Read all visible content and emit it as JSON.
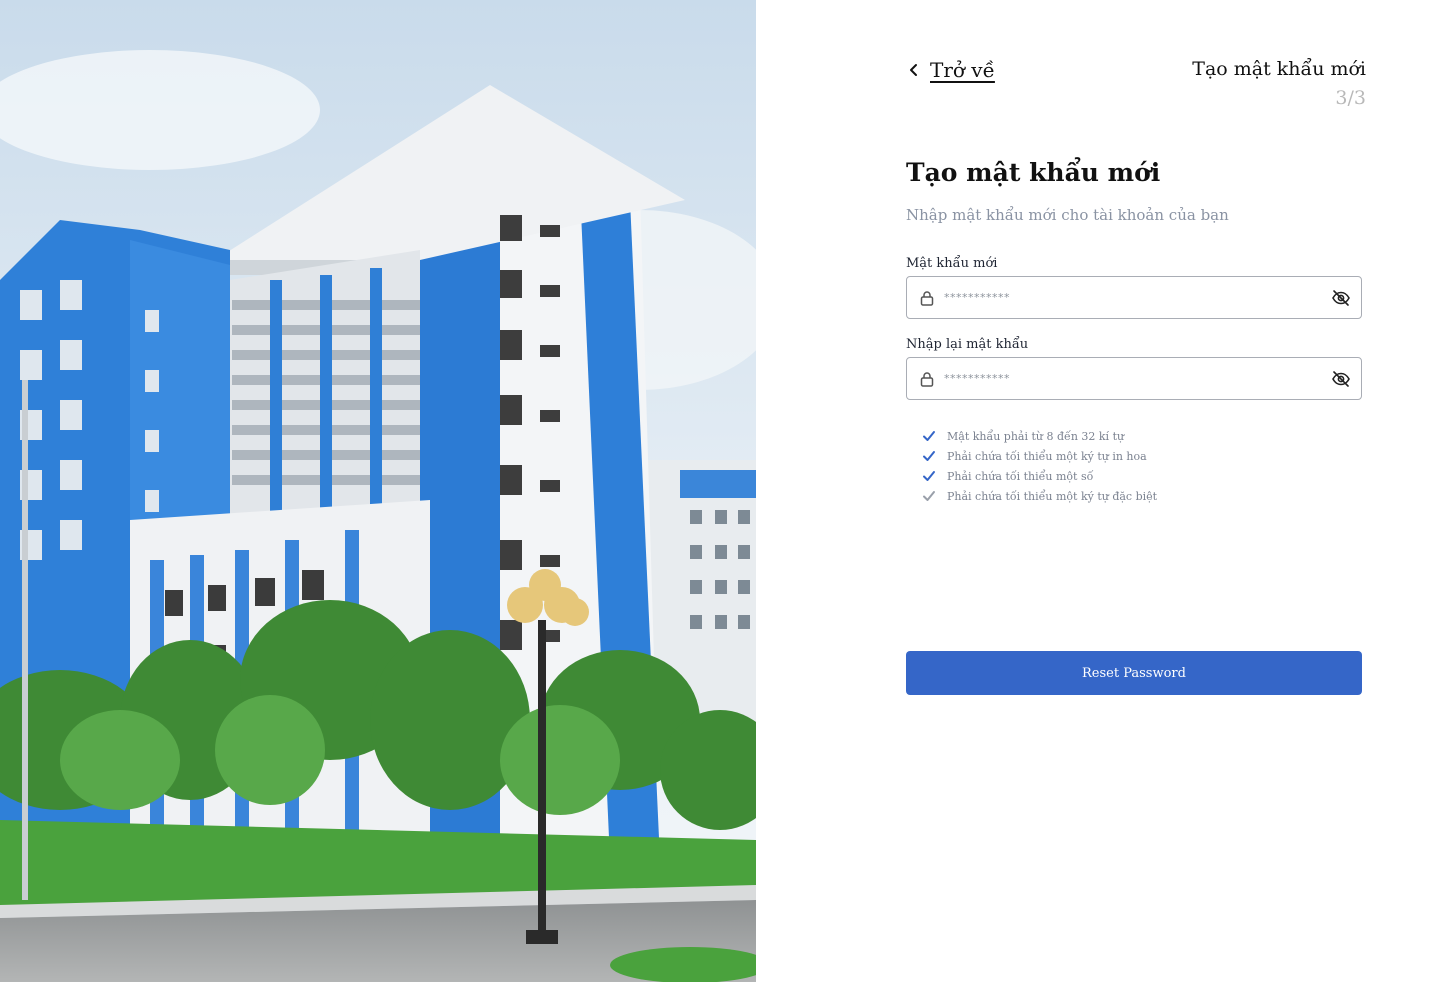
{
  "photo": {
    "alt_colors": {
      "sky": "#dfe9f2",
      "building_blue": "#2f7fd6",
      "grass": "#3f9c3a"
    }
  },
  "header": {
    "back_label": "Trở về",
    "step_title": "Tạo mật khẩu mới",
    "step_count": "3/3"
  },
  "form": {
    "heading": "Tạo mật khẩu mới",
    "subheading": "Nhập mật khẩu mới cho tài khoản của bạn",
    "new_password": {
      "label": "Mật khẩu mới",
      "placeholder": "***********",
      "value": ""
    },
    "confirm_password": {
      "label": "Nhập lại mật khẩu",
      "placeholder": "***********",
      "value": ""
    },
    "rules": [
      {
        "text": "Mật khẩu phải từ 8 đến 32 kí tự",
        "met": true
      },
      {
        "text": "Phải chứa tối thiểu một ký tự in hoa",
        "met": true
      },
      {
        "text": "Phải chứa tối thiểu một số",
        "met": true
      },
      {
        "text": "Phải chứa tối thiểu một ký tự đặc biệt",
        "met": false
      }
    ],
    "submit_label": "Reset Password"
  },
  "colors": {
    "accent": "#3566c8",
    "check_met": "#3566c8",
    "check_unmet": "#9aa0aa",
    "muted_text": "#8a93a3"
  },
  "icons": {
    "back": "chevron-left-icon",
    "lock": "lock-icon",
    "eye": "eye-off-icon",
    "check": "check-icon"
  }
}
